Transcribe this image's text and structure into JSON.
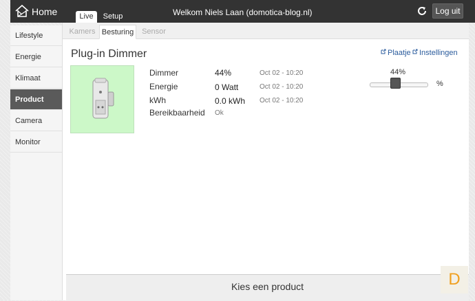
{
  "header": {
    "home_label": "Home",
    "tabs": [
      {
        "label": "Live"
      },
      {
        "label": "Setup"
      }
    ],
    "welcome": "Welkom Niels Laan (domotica-blog.nl)",
    "logout_label": "Log uit"
  },
  "sidebar": {
    "items": [
      {
        "label": "Lifestyle"
      },
      {
        "label": "Energie"
      },
      {
        "label": "Klimaat"
      },
      {
        "label": "Product"
      },
      {
        "label": "Camera"
      },
      {
        "label": "Monitor"
      }
    ],
    "active": "Product"
  },
  "subtabs": [
    {
      "label": "Kamers"
    },
    {
      "label": "Besturing"
    },
    {
      "label": "Sensor"
    }
  ],
  "product": {
    "title": "Plug-in Dimmer",
    "links": {
      "image": "Plaatje",
      "settings": "Instellingen"
    },
    "rows": [
      {
        "label": "Dimmer",
        "value": "44%",
        "time": "Oct 02 - 10:20"
      },
      {
        "label": "Energie",
        "value": "0 Watt",
        "time": "Oct 02 - 10:20"
      },
      {
        "label": "kWh",
        "value": "0.0 kWh",
        "time": "Oct 02 - 10:20"
      },
      {
        "label": "Bereikbaarheid",
        "value": "Ok",
        "time": ""
      }
    ],
    "slider": {
      "value_label": "44%",
      "level": 0.44,
      "unit": "%"
    }
  },
  "footer": {
    "choose_product": "Kies een product"
  },
  "logo": {
    "letter": "D"
  },
  "colors": {
    "topbar": "#333333",
    "active_sidebar": "#5a5a5a",
    "image_bg": "#ccf8c8",
    "link": "#2a5b9c"
  }
}
